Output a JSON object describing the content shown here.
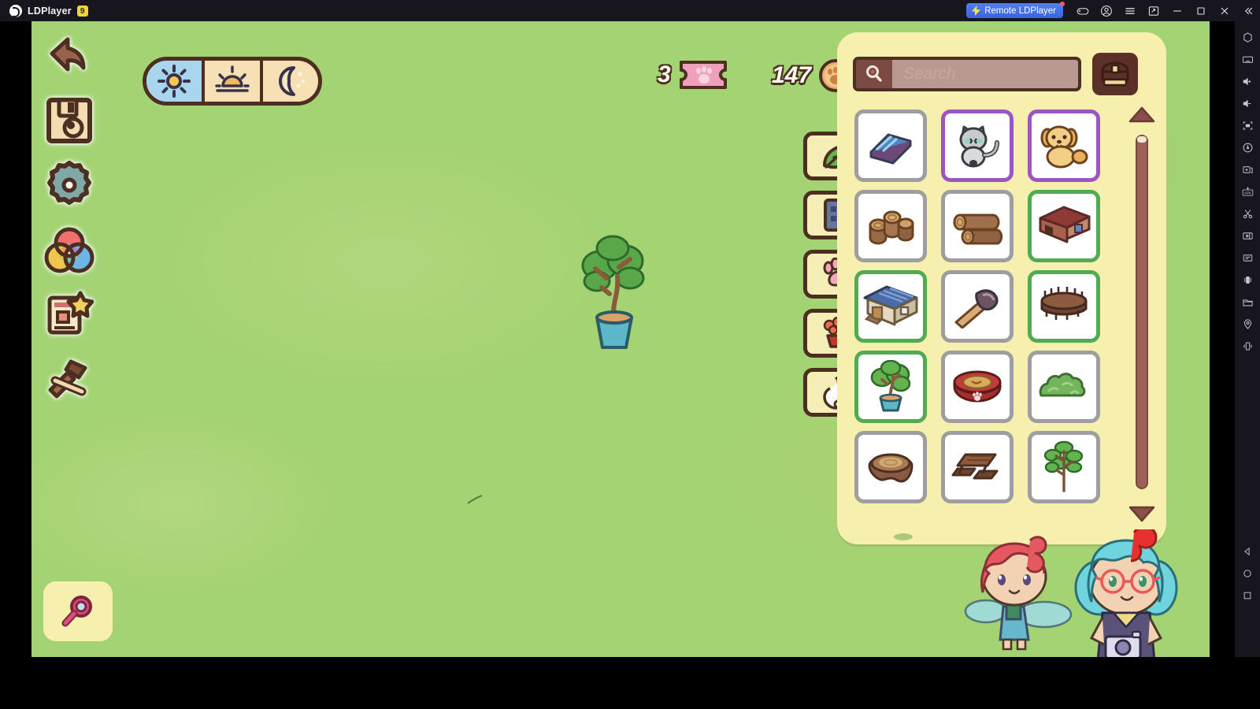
{
  "titlebar": {
    "brand": "LDPlayer",
    "version": "9",
    "remote_label": "Remote LDPlayer",
    "icons": [
      {
        "name": "gamepad-icon",
        "glyph": "gamepad"
      },
      {
        "name": "account-icon",
        "glyph": "account"
      },
      {
        "name": "menu-icon",
        "glyph": "menu"
      },
      {
        "name": "screenshot-icon",
        "glyph": "screenshot"
      },
      {
        "name": "minimize-icon",
        "glyph": "minimize"
      },
      {
        "name": "maximize-icon",
        "glyph": "maximize"
      },
      {
        "name": "close-icon",
        "glyph": "close"
      },
      {
        "name": "collapse-icon",
        "glyph": "collapse"
      }
    ]
  },
  "sidebar_right": {
    "items": [
      {
        "name": "settings-hex-icon"
      },
      {
        "name": "keyboard-icon"
      },
      {
        "name": "volume-up-icon"
      },
      {
        "name": "volume-down-icon"
      },
      {
        "name": "fullscreen-icon"
      },
      {
        "name": "auto-rotate-icon"
      },
      {
        "name": "add-instance-icon"
      },
      {
        "name": "apk-install-icon"
      },
      {
        "name": "scissors-icon"
      },
      {
        "name": "video-record-icon"
      },
      {
        "name": "script-icon"
      },
      {
        "name": "rotate-screen-icon"
      },
      {
        "name": "folder-icon"
      },
      {
        "name": "location-pin-icon"
      },
      {
        "name": "shake-icon"
      }
    ],
    "nav": [
      {
        "name": "android-back-button"
      },
      {
        "name": "android-home-button"
      },
      {
        "name": "android-recents-button"
      }
    ]
  },
  "game": {
    "tools": [
      {
        "name": "undo-button",
        "label": "Undo"
      },
      {
        "name": "save-button",
        "label": "Save"
      },
      {
        "name": "settings-button",
        "label": "Settings"
      },
      {
        "name": "color-palette-button",
        "label": "Colors"
      },
      {
        "name": "photo-mode-button",
        "label": "Photo"
      },
      {
        "name": "build-tools-button",
        "label": "Tools"
      }
    ],
    "time_of_day": {
      "selected": "day",
      "segments": [
        {
          "name": "time-day",
          "label": "Day"
        },
        {
          "name": "time-sunset",
          "label": "Sunset"
        },
        {
          "name": "time-night",
          "label": "Night"
        }
      ]
    },
    "currency": {
      "ticket_value": "3",
      "ticket_name": "paw-ticket",
      "coin_value": "147",
      "coin_name": "paw-coin"
    },
    "category_tabs": [
      {
        "name": "tab-nature",
        "label": "Nature"
      },
      {
        "name": "tab-buildings",
        "label": "Buildings"
      },
      {
        "name": "tab-pets",
        "label": "Pets"
      },
      {
        "name": "tab-flowers",
        "label": "Flowers"
      },
      {
        "name": "tab-animals",
        "label": "Animals"
      }
    ],
    "inventory": {
      "search_placeholder": "Search",
      "search_value": "",
      "chest_label": "Storage",
      "scroll": {
        "up_label": "Scroll up",
        "down_label": "Scroll down"
      },
      "items": [
        {
          "name": "item-book",
          "label": "Book",
          "border": "gray",
          "icon": "book"
        },
        {
          "name": "item-cat",
          "label": "Cat",
          "border": "purple",
          "icon": "cat"
        },
        {
          "name": "item-dog",
          "label": "Dog",
          "border": "purple",
          "icon": "dog"
        },
        {
          "name": "item-wood-stumps",
          "label": "Wood Stumps",
          "border": "gray",
          "icon": "stumps"
        },
        {
          "name": "item-logs",
          "label": "Logs",
          "border": "gray",
          "icon": "logs"
        },
        {
          "name": "item-red-house",
          "label": "Red House",
          "border": "green",
          "icon": "house-red"
        },
        {
          "name": "item-blue-house",
          "label": "Blue House",
          "border": "green",
          "icon": "house-blue"
        },
        {
          "name": "item-axe",
          "label": "Axe",
          "border": "gray",
          "icon": "axe"
        },
        {
          "name": "item-wooden-fence",
          "label": "Wooden Fence",
          "border": "green",
          "icon": "fence"
        },
        {
          "name": "item-potted-tree",
          "label": "Potted Tree",
          "border": "green",
          "icon": "potted-tree"
        },
        {
          "name": "item-food-bowl",
          "label": "Food Bowl",
          "border": "gray",
          "icon": "bowl"
        },
        {
          "name": "item-bush",
          "label": "Bush",
          "border": "gray",
          "icon": "bush"
        },
        {
          "name": "item-tree-stump",
          "label": "Tree Stump",
          "border": "gray",
          "icon": "stump"
        },
        {
          "name": "item-picnic-table",
          "label": "Picnic Table",
          "border": "gray",
          "icon": "table"
        },
        {
          "name": "item-tall-tree",
          "label": "Tall Tree",
          "border": "gray",
          "icon": "tall-tree"
        }
      ]
    },
    "scene": {
      "placed_object": "potted-tree",
      "characters": [
        {
          "name": "fairy-character",
          "label": "Red-haired Fairy"
        },
        {
          "name": "girl-character",
          "label": "Blue-haired Girl with Camera"
        }
      ]
    },
    "mini_search_label": "Search World"
  },
  "colors": {
    "grass": "#a4d373",
    "panel": "#f6efae",
    "dark_brown": "#4d2f22",
    "accent_blue": "#4f7ff0",
    "border_green": "#51ab52",
    "border_purple": "#9b56c2",
    "border_gray": "#9e9e9e"
  }
}
